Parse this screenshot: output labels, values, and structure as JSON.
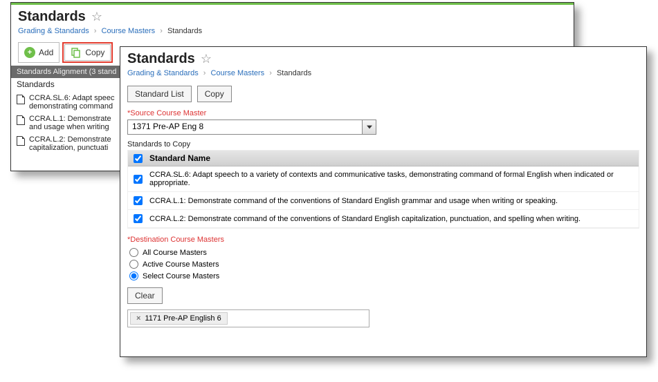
{
  "back": {
    "title": "Standards",
    "breadcrumb": {
      "b1": "Grading & Standards",
      "b2": "Course Masters",
      "current": "Standards"
    },
    "buttons": {
      "add": "Add",
      "copy": "Copy"
    },
    "grid": {
      "header": "Standards Alignment (3 stand",
      "col": "Standards",
      "rows": {
        "r0": "CCRA.SL.6: Adapt speec\ndemonstrating command",
        "r1": "CCRA.L.1: Demonstrate\nand usage when writing",
        "r2": "CCRA.L.2: Demonstrate\ncapitalization, punctuati"
      }
    }
  },
  "front": {
    "title": "Standards",
    "breadcrumb": {
      "b1": "Grading & Standards",
      "b2": "Course Masters",
      "current": "Standards"
    },
    "tabs": {
      "list": "Standard List",
      "copy": "Copy"
    },
    "source": {
      "label": "*Source Course Master",
      "value": "1371 Pre-AP Eng 8"
    },
    "copySection": "Standards to Copy",
    "colHeader": "Standard Name",
    "rows": {
      "r0": "CCRA.SL.6: Adapt speech to a variety of contexts and communicative tasks, demonstrating command of formal English when indicated or appropriate.",
      "r1": "CCRA.L.1: Demonstrate command of the conventions of Standard English grammar and usage when writing or speaking.",
      "r2": "CCRA.L.2: Demonstrate command of the conventions of Standard English capitalization, punctuation, and spelling when writing."
    },
    "dest": {
      "label": "*Destination Course Masters",
      "opts": {
        "all": "All Course Masters",
        "active": "Active Course Masters",
        "select": "Select Course Masters"
      }
    },
    "clear": "Clear",
    "chip": "1171 Pre-AP English 6"
  }
}
